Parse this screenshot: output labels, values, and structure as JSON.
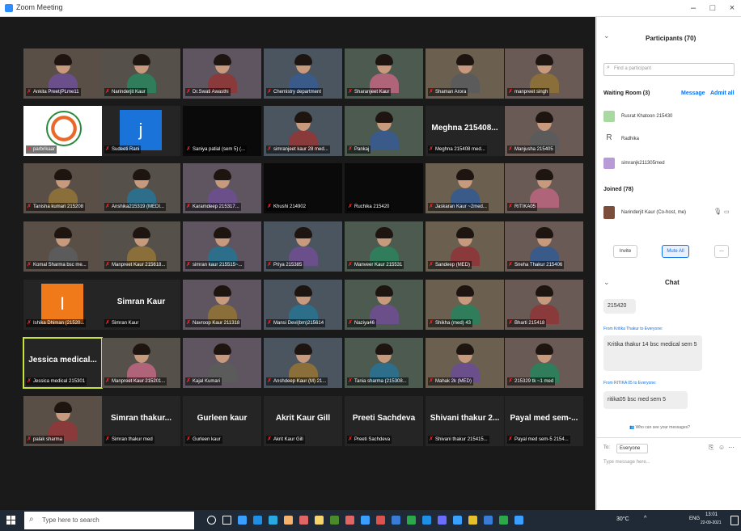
{
  "window": {
    "title": "Zoom Meeting",
    "minimize": "–",
    "maximize": "□",
    "close": "×"
  },
  "tiles": [
    {
      "name": "Ankita Preet(PLme11",
      "kind": "video"
    },
    {
      "name": "Narinderjit Kaur",
      "kind": "video"
    },
    {
      "name": "Dr.Swati Awasthi",
      "kind": "video"
    },
    {
      "name": "Chemistry department",
      "kind": "video"
    },
    {
      "name": "Sharanjeet Kaur",
      "kind": "video"
    },
    {
      "name": "Shaman Arora",
      "kind": "video"
    },
    {
      "name": "manpreet singh",
      "kind": "video"
    },
    {
      "name": "parbrikaar",
      "kind": "logo"
    },
    {
      "name": "Sudeeti Rani",
      "kind": "avatar",
      "letter": "j",
      "color": "#1a73d9"
    },
    {
      "name": "Saniya patial (sem 5) (...",
      "kind": "black"
    },
    {
      "name": "simranjeet kaur 28 med...",
      "kind": "video"
    },
    {
      "name": "Pankaj",
      "kind": "video"
    },
    {
      "name": "Meghna 215408 med...",
      "kind": "bigname",
      "big": "Meghna 215408..."
    },
    {
      "name": "Manjusha 215405",
      "kind": "video"
    },
    {
      "name": "Tanisha kumari 215208",
      "kind": "video"
    },
    {
      "name": "Anshika215319 (MEDI...",
      "kind": "video"
    },
    {
      "name": "Karamdeep 215317...",
      "kind": "video"
    },
    {
      "name": "Khushi 214902",
      "kind": "black"
    },
    {
      "name": "Ruchika 215420",
      "kind": "black"
    },
    {
      "name": "Jaskaran Kaur ~2med...",
      "kind": "video"
    },
    {
      "name": "RITIKA05",
      "kind": "video"
    },
    {
      "name": "Komal Sharma bsc me...",
      "kind": "video"
    },
    {
      "name": "Manpreet Kaur 215618...",
      "kind": "video"
    },
    {
      "name": "simran kaur 215515~...",
      "kind": "video"
    },
    {
      "name": "Priya 215385",
      "kind": "video"
    },
    {
      "name": "Manveer Kaur 215531",
      "kind": "video"
    },
    {
      "name": "Sandeep (MED)",
      "kind": "video"
    },
    {
      "name": "Sneha Thakur 215406",
      "kind": "video"
    },
    {
      "name": "Ishika Dhiman (21520...",
      "kind": "avatar",
      "letter": "I",
      "color": "#f07a1a"
    },
    {
      "name": "Simran Kaur",
      "kind": "bigname",
      "big": "Simran Kaur"
    },
    {
      "name": "Navroop Kaur 211318",
      "kind": "video"
    },
    {
      "name": "Mansi Devi(bm)215614",
      "kind": "video"
    },
    {
      "name": "Naziya46",
      "kind": "video"
    },
    {
      "name": "Shikha (med) 43",
      "kind": "video"
    },
    {
      "name": "Bharti 215418",
      "kind": "video"
    },
    {
      "name": "Jessica medical 215301",
      "kind": "bigname",
      "big": "Jessica medical...",
      "active": true
    },
    {
      "name": "Manpreet Kaur 215201...",
      "kind": "video"
    },
    {
      "name": "Kajal Kumari",
      "kind": "video"
    },
    {
      "name": "Anshdeep Kaur (M) 21...",
      "kind": "video"
    },
    {
      "name": "Tania sharma (215308...",
      "kind": "video"
    },
    {
      "name": "Mahak 2k (MED)",
      "kind": "video"
    },
    {
      "name": "215329 tk ~1 med",
      "kind": "video"
    },
    {
      "name": "palak sharma",
      "kind": "video"
    },
    {
      "name": "Simran thakur med",
      "kind": "bigname",
      "big": "Simran thakur..."
    },
    {
      "name": "Gurleen kaur",
      "kind": "bigname",
      "big": "Gurleen kaur"
    },
    {
      "name": "Akrit Kaur Gill",
      "kind": "bigname",
      "big": "Akrit Kaur Gill"
    },
    {
      "name": "Preeti Sachdeva",
      "kind": "bigname",
      "big": "Preeti Sachdeva"
    },
    {
      "name": "Shivani thakur 215415...",
      "kind": "bigname",
      "big": "Shivani thakur 2..."
    },
    {
      "name": "Payal med sem-5 2154...",
      "kind": "bigname",
      "big": "Payal med sem-..."
    }
  ],
  "participants": {
    "title": "Participants (70)",
    "search_placeholder": "Find a participant",
    "waiting_room_label": "Waiting Room (3)",
    "message_label": "Message",
    "admit_all_label": "Admit all",
    "waiting": [
      {
        "name": "Rusrat Khatoon 215430",
        "avatar": "",
        "color": "#a7d9a0"
      },
      {
        "name": "Radhika",
        "avatar": "R",
        "color": "#ffffff"
      },
      {
        "name": "simranjk211305med",
        "avatar": "",
        "color": "#b89ad6"
      }
    ],
    "joined_label": "Joined (78)",
    "host": {
      "name": "Narinderjit Kaur (Co-host, me)"
    },
    "invite_label": "Invite",
    "mute_all_label": "Mute All",
    "more_label": "..."
  },
  "chat": {
    "title": "Chat",
    "messages": [
      {
        "from": "",
        "text": "215420"
      },
      {
        "from": "From Kritika Thakur to Everyone:",
        "text": "Kritika thakur 14 bsc medical sem 5"
      },
      {
        "from": "From RITIKA 05 to Everyone:",
        "text": "ritika05 bsc med sem 5"
      }
    ],
    "who_can_see": "Who can see your messages?",
    "to_label": "To:",
    "recipient": "Everyone",
    "input_placeholder": "Type message here..."
  },
  "taskbar": {
    "search_placeholder": "Type here to search",
    "weather": "30°C",
    "lang": "ENG",
    "time": "13:01",
    "date": "22-09-2021"
  },
  "colors": {
    "gallery_bg": "#1a1a1a",
    "accent": "#0e72ed",
    "taskbar": "#1f2a36"
  }
}
